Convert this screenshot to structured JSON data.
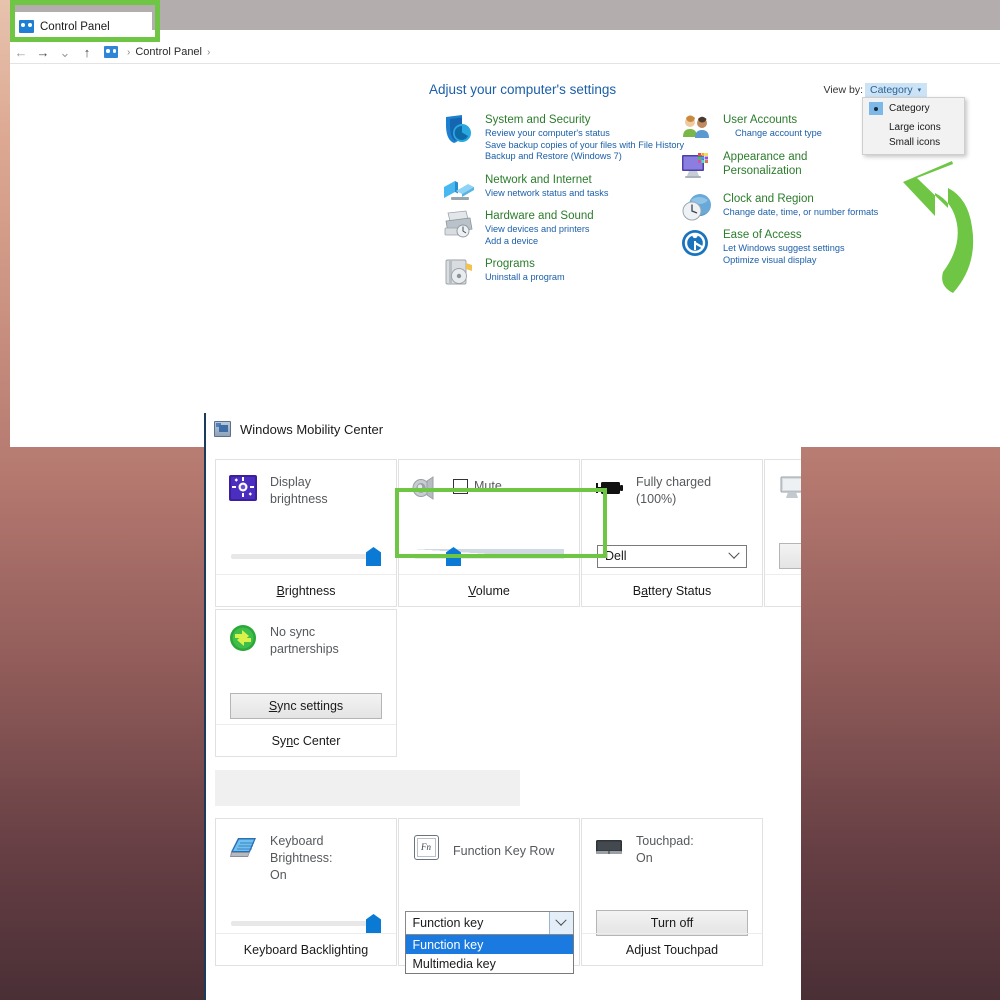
{
  "control_panel": {
    "tab_label": "Control Panel",
    "tab_icon": "control-panel-icon",
    "nav": {
      "back": "←",
      "forward": "→",
      "recent": "⌄",
      "up": "↑",
      "breadcrumb_icon": "control-panel-icon",
      "breadcrumb_sep_1": "›",
      "breadcrumb_item": "Control Panel",
      "breadcrumb_sep_2": "›"
    },
    "heading": "Adjust your computer's settings",
    "view_by": {
      "label": "View by:",
      "value": "Category",
      "caret": "▾",
      "options": [
        {
          "label": "Category",
          "selected": true
        },
        {
          "label": "Large icons",
          "selected": false
        },
        {
          "label": "Small icons",
          "selected": false
        }
      ]
    },
    "categories_left": [
      {
        "icon": "shield-icon",
        "title": "System and Security",
        "links": [
          "Review your computer's status",
          "Save backup copies of your files with File History",
          "Backup and Restore (Windows 7)"
        ]
      },
      {
        "icon": "network-icon",
        "title": "Network and Internet",
        "links": [
          "View network status and tasks"
        ]
      },
      {
        "icon": "printer-icon",
        "title": "Hardware and Sound",
        "links": [
          "View devices and printers",
          "Add a device"
        ]
      },
      {
        "icon": "programs-icon",
        "title": "Programs",
        "links": [
          "Uninstall a program"
        ]
      }
    ],
    "categories_right": [
      {
        "icon": "user-accounts-icon",
        "title": "User Accounts",
        "links": [
          "Change account type"
        ],
        "shield_on_first_link": true
      },
      {
        "icon": "appearance-icon",
        "title": "Appearance and Personalization",
        "links": []
      },
      {
        "icon": "clock-icon",
        "title": "Clock and Region",
        "links": [
          "Change date, time, or number formats"
        ]
      },
      {
        "icon": "ease-of-access-icon",
        "title": "Ease of Access",
        "links": [
          "Let Windows suggest settings",
          "Optimize visual display"
        ]
      }
    ]
  },
  "mobility_center": {
    "title": "Windows Mobility Center",
    "title_icon": "mobility-center-icon",
    "tiles": {
      "display_brightness": {
        "icon": "brightness-icon",
        "text": "Display\nbrightness",
        "text_line1": "Display",
        "text_line2": "brightness",
        "footer": "Brightness",
        "slider_value": 100
      },
      "volume": {
        "icon": "speaker-icon",
        "checkbox_label": "Mute",
        "checked": false,
        "footer": "Volume",
        "slider_value": 26
      },
      "battery_status": {
        "icon": "battery-icon",
        "text_line1": "Fully charged",
        "text_line2": "(100%)",
        "combo_value": "Dell",
        "footer": "Battery Status"
      },
      "external_display": {
        "icon": "monitor-icon"
      },
      "sync_center": {
        "icon": "sync-icon",
        "text_line1": "No sync",
        "text_line2": "partnerships",
        "button_label": "Sync settings",
        "footer": "Sync Center"
      },
      "keyboard_backlighting": {
        "icon": "keyboard-icon",
        "text_line1": "Keyboard",
        "text_line2": "Brightness:",
        "text_line3": "On",
        "footer": "Keyboard Backlighting",
        "slider_value": 100
      },
      "function_key_row": {
        "icon": "fn-key-icon",
        "icon_label": "Fn",
        "text": "Function Key Row",
        "combo_value": "Function key",
        "options": [
          {
            "label": "Function key",
            "selected": true
          },
          {
            "label": "Multimedia key",
            "selected": false
          }
        ]
      },
      "touchpad": {
        "icon": "touchpad-icon",
        "text_line1": "Touchpad:",
        "text_line2": "On",
        "button_label": "Turn off",
        "footer": "Adjust Touchpad"
      }
    }
  },
  "annotations": {
    "highlight_color": "#6ec644",
    "arrow": "curved-up-arrow",
    "arrow_color": "#6ec644"
  }
}
